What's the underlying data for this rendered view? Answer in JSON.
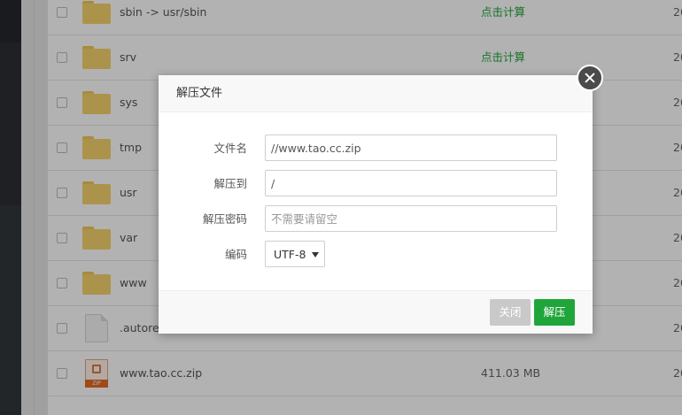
{
  "file_list": {
    "rows": [
      {
        "name": "sbin -> usr/sbin",
        "type": "folder",
        "size": "点击计算",
        "size_kind": "calc",
        "date": "20"
      },
      {
        "name": "srv",
        "type": "folder",
        "size": "点击计算",
        "size_kind": "calc",
        "date": "20"
      },
      {
        "name": "sys",
        "type": "folder",
        "size": "",
        "size_kind": "calc",
        "date": "20"
      },
      {
        "name": "tmp",
        "type": "folder",
        "size": "",
        "size_kind": "calc",
        "date": "20"
      },
      {
        "name": "usr",
        "type": "folder",
        "size": "",
        "size_kind": "calc",
        "date": "20"
      },
      {
        "name": "var",
        "type": "folder",
        "size": "",
        "size_kind": "calc",
        "date": "20"
      },
      {
        "name": "www",
        "type": "folder",
        "size": "",
        "size_kind": "calc",
        "date": "20"
      },
      {
        "name": ".autorel",
        "type": "file",
        "size": "",
        "size_kind": "plain",
        "date": "20"
      },
      {
        "name": "www.tao.cc.zip",
        "type": "zip",
        "size": "411.03 MB",
        "size_kind": "plain",
        "date": "20"
      }
    ],
    "zip_icon_text": "ZIP"
  },
  "dialog": {
    "title": "解压文件",
    "fields": {
      "filename_label": "文件名",
      "filename_value": "//www.tao.cc.zip",
      "extract_to_label": "解压到",
      "extract_to_value": "/",
      "password_label": "解压密码",
      "password_placeholder": "不需要请留空",
      "encoding_label": "编码",
      "encoding_value": "UTF-8"
    },
    "buttons": {
      "close": "关闭",
      "extract": "解压"
    }
  },
  "colors": {
    "accent_green": "#20a53a",
    "folder_yellow": "#f6d36e",
    "disabled_gray": "#c9c9c9"
  }
}
